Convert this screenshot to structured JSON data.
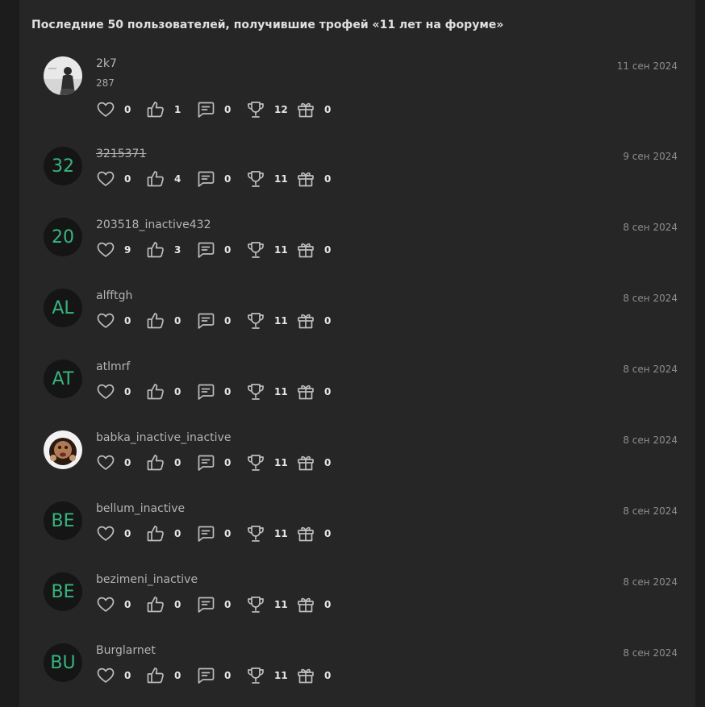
{
  "header": {
    "title": "Последние 50 пользователей, получившие трофей «11 лет на форуме»"
  },
  "colors": {
    "page_bg": "#1c1c1c",
    "panel_bg": "#262626",
    "avatar_initials": "#37b57f",
    "icon_stroke": "#bdbdbd"
  },
  "stat_icons": [
    "heart-icon",
    "thumbs-up-icon",
    "message-icon",
    "trophy-icon",
    "gift-icon"
  ],
  "users": [
    {
      "username": "2k7",
      "subvalue": "287",
      "avatar": {
        "type": "image",
        "initials": ""
      },
      "date": "11 сен 2024",
      "stats": {
        "likes": "0",
        "thumbs": "1",
        "messages": "0",
        "trophies": "12",
        "gifts": "0"
      },
      "struck": false
    },
    {
      "username": "3215371",
      "avatar": {
        "type": "initials",
        "initials": "32"
      },
      "date": "9 сен 2024",
      "stats": {
        "likes": "0",
        "thumbs": "4",
        "messages": "0",
        "trophies": "11",
        "gifts": "0"
      },
      "struck": true
    },
    {
      "username": "203518_inactive432",
      "avatar": {
        "type": "initials",
        "initials": "20"
      },
      "date": "8 сен 2024",
      "stats": {
        "likes": "9",
        "thumbs": "3",
        "messages": "0",
        "trophies": "11",
        "gifts": "0"
      },
      "struck": false
    },
    {
      "username": "alfftgh",
      "avatar": {
        "type": "initials",
        "initials": "AL"
      },
      "date": "8 сен 2024",
      "stats": {
        "likes": "0",
        "thumbs": "0",
        "messages": "0",
        "trophies": "11",
        "gifts": "0"
      },
      "struck": false
    },
    {
      "username": "atlmrf",
      "avatar": {
        "type": "initials",
        "initials": "AT"
      },
      "date": "8 сен 2024",
      "stats": {
        "likes": "0",
        "thumbs": "0",
        "messages": "0",
        "trophies": "11",
        "gifts": "0"
      },
      "struck": false
    },
    {
      "username": "babka_inactive_inactive",
      "avatar": {
        "type": "image",
        "initials": ""
      },
      "date": "8 сен 2024",
      "stats": {
        "likes": "0",
        "thumbs": "0",
        "messages": "0",
        "trophies": "11",
        "gifts": "0"
      },
      "struck": false
    },
    {
      "username": "bellum_inactive",
      "avatar": {
        "type": "initials",
        "initials": "BE"
      },
      "date": "8 сен 2024",
      "stats": {
        "likes": "0",
        "thumbs": "0",
        "messages": "0",
        "trophies": "11",
        "gifts": "0"
      },
      "struck": false
    },
    {
      "username": "bezimeni_inactive",
      "avatar": {
        "type": "initials",
        "initials": "BE"
      },
      "date": "8 сен 2024",
      "stats": {
        "likes": "0",
        "thumbs": "0",
        "messages": "0",
        "trophies": "11",
        "gifts": "0"
      },
      "struck": false
    },
    {
      "username": "Burglarnet",
      "avatar": {
        "type": "initials",
        "initials": "BU"
      },
      "date": "8 сен 2024",
      "stats": {
        "likes": "0",
        "thumbs": "0",
        "messages": "0",
        "trophies": "11",
        "gifts": "0"
      },
      "struck": false
    }
  ]
}
